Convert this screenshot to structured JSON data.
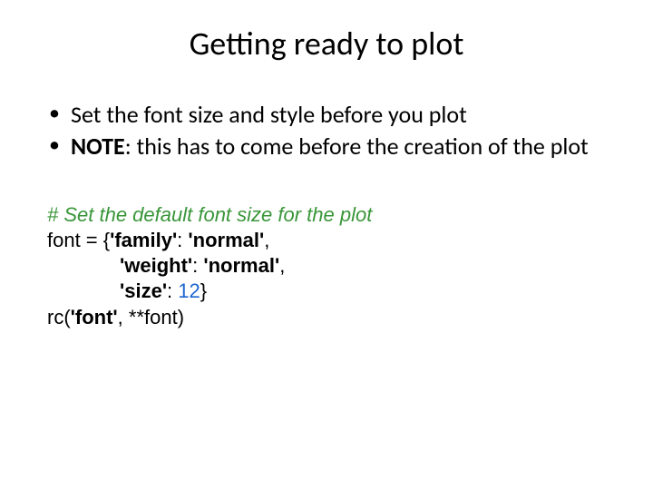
{
  "title": "Getting ready to plot",
  "bullets": {
    "b1": "Set the font size and style before you plot",
    "b2_prefix": "NOTE",
    "b2_rest": ": this has to come before the creation of the plot"
  },
  "code": {
    "comment": "# Set the default font size for the plot",
    "l1_a": "font = {",
    "l1_key": "'family'",
    "l1_colon": ": ",
    "l1_val": "'normal'",
    "l1_end": ",",
    "l2_key": "'weight'",
    "l2_colon": ": ",
    "l2_val": "'normal'",
    "l2_end": ",",
    "l3_key": "'size'",
    "l3_colon": ": ",
    "l3_val": "12",
    "l3_end": "}",
    "l4_a": "rc(",
    "l4_arg1": "'font'",
    "l4_mid": ", **font)"
  }
}
